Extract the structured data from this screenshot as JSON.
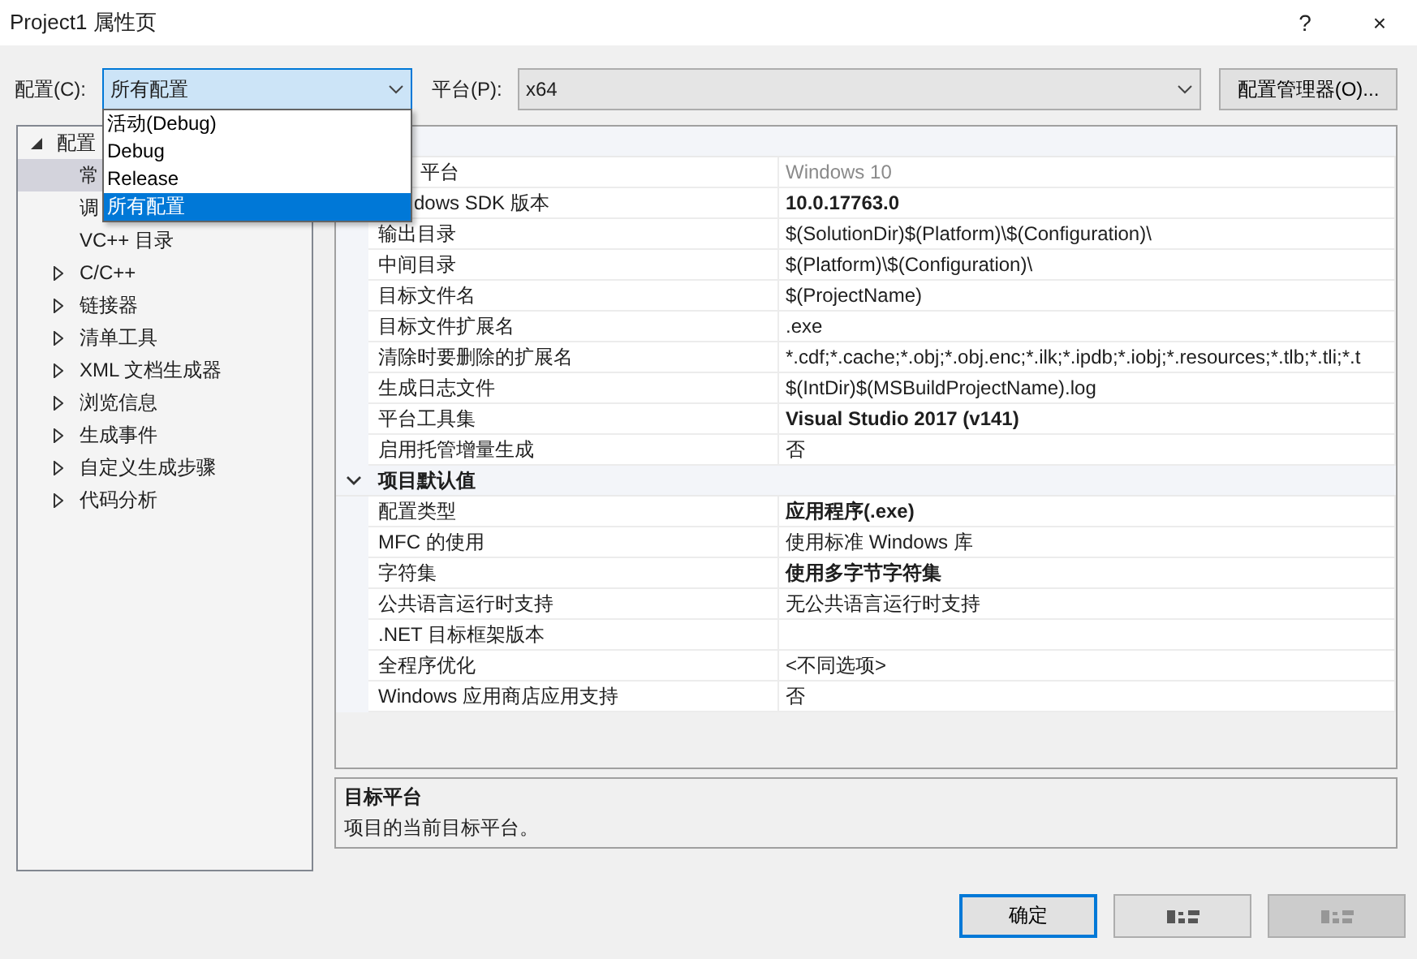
{
  "window": {
    "title": "Project1 属性页",
    "help": "?",
    "close": "×"
  },
  "config": {
    "label": "配置(C):",
    "value": "所有配置",
    "open": true,
    "options": [
      {
        "label": "活动(Debug)",
        "selected": false
      },
      {
        "label": "Debug",
        "selected": false
      },
      {
        "label": "Release",
        "selected": false
      },
      {
        "label": "所有配置",
        "selected": true
      }
    ]
  },
  "platform": {
    "label": "平台(P):",
    "value": "x64"
  },
  "config_manager_button": "配置管理器(O)...",
  "tree": [
    {
      "label": "配置",
      "kind": "folder",
      "expanded": true,
      "selected": false,
      "children": [
        {
          "label": "常",
          "kind": "leaf",
          "selected": true
        },
        {
          "label": "调",
          "kind": "leaf",
          "selected": false
        },
        {
          "label": "VC++ 目录",
          "kind": "leaf",
          "selected": false
        },
        {
          "label": "C/C++",
          "kind": "folder",
          "expanded": false,
          "selected": false
        },
        {
          "label": "链接器",
          "kind": "folder",
          "expanded": false,
          "selected": false
        },
        {
          "label": "清单工具",
          "kind": "folder",
          "expanded": false,
          "selected": false
        },
        {
          "label": "XML 文档生成器",
          "kind": "folder",
          "expanded": false,
          "selected": false
        },
        {
          "label": "浏览信息",
          "kind": "folder",
          "expanded": false,
          "selected": false
        },
        {
          "label": "生成事件",
          "kind": "folder",
          "expanded": false,
          "selected": false
        },
        {
          "label": "自定义生成步骤",
          "kind": "folder",
          "expanded": false,
          "selected": false
        },
        {
          "label": "代码分析",
          "kind": "folder",
          "expanded": false,
          "selected": false
        }
      ]
    }
  ],
  "grid": {
    "groups": [
      {
        "expanded": true,
        "rows": [
          {
            "name": "平台",
            "value": "Windows 10",
            "bold": false,
            "disabled": true
          },
          {
            "name": "dows SDK 版本",
            "value": "10.0.17763.0",
            "bold": true,
            "disabled": false
          },
          {
            "name": "输出目录",
            "value": "$(SolutionDir)$(Platform)\\$(Configuration)\\",
            "bold": false,
            "disabled": false
          },
          {
            "name": "中间目录",
            "value": "$(Platform)\\$(Configuration)\\",
            "bold": false,
            "disabled": false
          },
          {
            "name": "目标文件名",
            "value": "$(ProjectName)",
            "bold": false,
            "disabled": false
          },
          {
            "name": "目标文件扩展名",
            "value": ".exe",
            "bold": false,
            "disabled": false
          },
          {
            "name": "清除时要删除的扩展名",
            "value": "*.cdf;*.cache;*.obj;*.obj.enc;*.ilk;*.ipdb;*.iobj;*.resources;*.tlb;*.tli;*.t",
            "bold": false,
            "disabled": false
          },
          {
            "name": "生成日志文件",
            "value": "$(IntDir)$(MSBuildProjectName).log",
            "bold": false,
            "disabled": false
          },
          {
            "name": "平台工具集",
            "value": "Visual Studio 2017 (v141)",
            "bold": true,
            "disabled": false
          },
          {
            "name": "启用托管增量生成",
            "value": "否",
            "bold": false,
            "disabled": false
          }
        ]
      },
      {
        "title": "项目默认值",
        "expanded": true,
        "rows": [
          {
            "name": "配置类型",
            "value": "应用程序(.exe)",
            "bold": true,
            "disabled": false
          },
          {
            "name": "MFC 的使用",
            "value": "使用标准 Windows 库",
            "bold": false,
            "disabled": false
          },
          {
            "name": "字符集",
            "value": "使用多字节字符集",
            "bold": true,
            "disabled": false
          },
          {
            "name": "公共语言运行时支持",
            "value": "无公共语言运行时支持",
            "bold": false,
            "disabled": false
          },
          {
            "name": ".NET 目标框架版本"
          },
          {
            "name": "全程序优化",
            "value": "<不同选项>",
            "bold": false,
            "disabled": false
          },
          {
            "name": "Windows 应用商店应用支持",
            "value": "否",
            "bold": false,
            "disabled": false
          }
        ]
      }
    ]
  },
  "description": {
    "title": "目标平台",
    "text": "项目的当前目标平台。"
  },
  "buttons": [
    {
      "label": "确定",
      "default": true,
      "disabled": false
    },
    {
      "default": false,
      "disabled": false
    },
    {
      "default": false,
      "disabled": true
    }
  ]
}
